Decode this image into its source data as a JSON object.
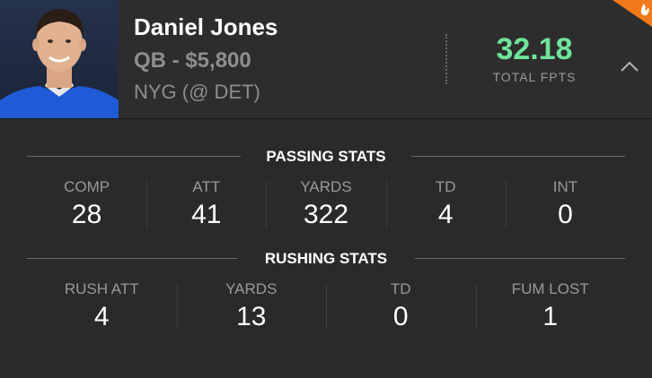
{
  "player": {
    "name": "Daniel Jones",
    "position_salary": "QB - $5,800",
    "matchup": "NYG (@ DET)"
  },
  "fpts": {
    "value": "32.18",
    "label": "TOTAL FPTS"
  },
  "passing": {
    "title": "PASSING STATS",
    "stats": [
      {
        "label": "COMP",
        "value": "28"
      },
      {
        "label": "ATT",
        "value": "41"
      },
      {
        "label": "YARDS",
        "value": "322"
      },
      {
        "label": "TD",
        "value": "4"
      },
      {
        "label": "INT",
        "value": "0"
      }
    ]
  },
  "rushing": {
    "title": "RUSHING STATS",
    "stats": [
      {
        "label": "RUSH ATT",
        "value": "4"
      },
      {
        "label": "YARDS",
        "value": "13"
      },
      {
        "label": "TD",
        "value": "0"
      },
      {
        "label": "FUM LOST",
        "value": "1"
      }
    ]
  },
  "colors": {
    "fpts": "#6fe39b",
    "hot_badge": "#f07a1a",
    "background": "#2a2a2a"
  },
  "icons": {
    "collapse": "chevron-up-icon",
    "hot": "flame-icon"
  }
}
